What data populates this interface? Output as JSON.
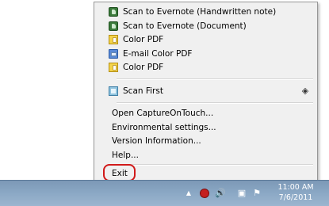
{
  "menu": {
    "items": [
      {
        "label": "Scan to Evernote (Handwritten note)",
        "icon": "evernote-icon"
      },
      {
        "label": "Scan to Evernote (Document)",
        "icon": "evernote-icon"
      },
      {
        "label": "Color PDF",
        "icon": "pdf-icon"
      },
      {
        "label": "E-mail Color PDF",
        "icon": "email-icon"
      },
      {
        "label": "Color PDF",
        "icon": "pdf-icon"
      }
    ],
    "scan_first": {
      "label": "Scan First",
      "icon": "scan-first-icon",
      "marker_icon": "diamond-icon"
    },
    "options": [
      {
        "label": "Open CaptureOnTouch..."
      },
      {
        "label": "Environmental settings..."
      },
      {
        "label": "Version Information..."
      },
      {
        "label": "Help..."
      }
    ],
    "exit": {
      "label": "Exit",
      "highlight_color": "#d11a1a"
    }
  },
  "taskbar": {
    "tray_icons": [
      "show-hidden-icons-arrow-icon",
      "capture-on-touch-icon",
      "speaker-icon",
      "network-icon",
      "action-center-flag-icon"
    ],
    "clock_time": "11:00 AM",
    "clock_date": "7/6/2011"
  }
}
